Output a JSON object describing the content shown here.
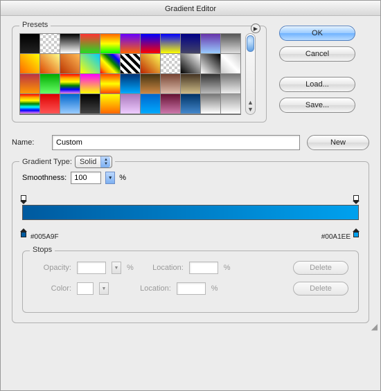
{
  "title": "Gradient Editor",
  "presets": {
    "label": "Presets"
  },
  "buttons": {
    "ok": "OK",
    "cancel": "Cancel",
    "load": "Load...",
    "save": "Save..."
  },
  "name": {
    "label": "Name:",
    "value": "Custom",
    "new": "New"
  },
  "gtype": {
    "label": "Gradient Type:",
    "value": "Solid"
  },
  "smoothness": {
    "label": "Smoothness:",
    "value": "100",
    "pct": "%"
  },
  "gradient": {
    "start": "#005A9F",
    "end": "#00A1EE",
    "start_label": "#005A9F",
    "end_label": "#00A1EE"
  },
  "stops": {
    "label": "Stops",
    "opacity": "Opacity:",
    "color": "Color:",
    "location": "Location:",
    "pct": "%",
    "delete": "Delete"
  },
  "preset_swatches": [
    "linear-gradient(#000,#222)",
    "repeating-conic-gradient(#ccc 0 25%,#fff 0 50%) 0/8px 8px",
    "linear-gradient(#000,#fff)",
    "linear-gradient(#f33,#2d2)",
    "linear-gradient(#f60,#ff0,#0f0)",
    "linear-gradient(#60f,#f60)",
    "linear-gradient(#00f,#f00)",
    "linear-gradient(#00f,#ff0)",
    "linear-gradient(#008,#446)",
    "linear-gradient(#63a,#9cf)",
    "linear-gradient(#555,#ddd)",
    "linear-gradient(45deg,#f60,#ff0)",
    "linear-gradient(45deg,#d40,#ff8)",
    "linear-gradient(45deg,#b30,#fb5)",
    "linear-gradient(45deg,#ff0,#0cf)",
    "linear-gradient(45deg,red,orange,yellow,green,blue,violet)",
    "repeating-linear-gradient(45deg,#000 0 4px,#fff 4px 8px)",
    "linear-gradient(45deg,#b20,#ff5)",
    "repeating-conic-gradient(#ccc 0 25%,#fff 0 50%) 0/8px 8px",
    "linear-gradient(45deg,#000,#fff)",
    "linear-gradient(45deg,#fff,#000)",
    "linear-gradient(45deg,#ccc,#fff,#ccc)",
    "linear-gradient(#b34,#f90)",
    "linear-gradient(#0a0,#6f6)",
    "linear-gradient(red,orange,yellow,green,blue,violet)",
    "linear-gradient(#f0f,#ff0)",
    "linear-gradient(#f40,#ff0,#f40)",
    "linear-gradient(#037,#0af)",
    "linear-gradient(#431,#c84)",
    "linear-gradient(#743,#dba)",
    "linear-gradient(#432,#cb8)",
    "linear-gradient(#333,#bbb)",
    "linear-gradient(#777,#eee)",
    "linear-gradient(red,orange,yellow,green,cyan,blue,violet)",
    "linear-gradient(#d00,#f55)",
    "linear-gradient(#06c,#9cf)",
    "linear-gradient(#000,#444)",
    "linear-gradient(#ff0,#f60)",
    "linear-gradient(#a7b,#ecf)",
    "linear-gradient(#06c,#0af)",
    "linear-gradient(#613,#c7a)",
    "linear-gradient(#036,#48c)",
    "linear-gradient(#777,#fff)",
    "linear-gradient(#999,#fff)"
  ]
}
